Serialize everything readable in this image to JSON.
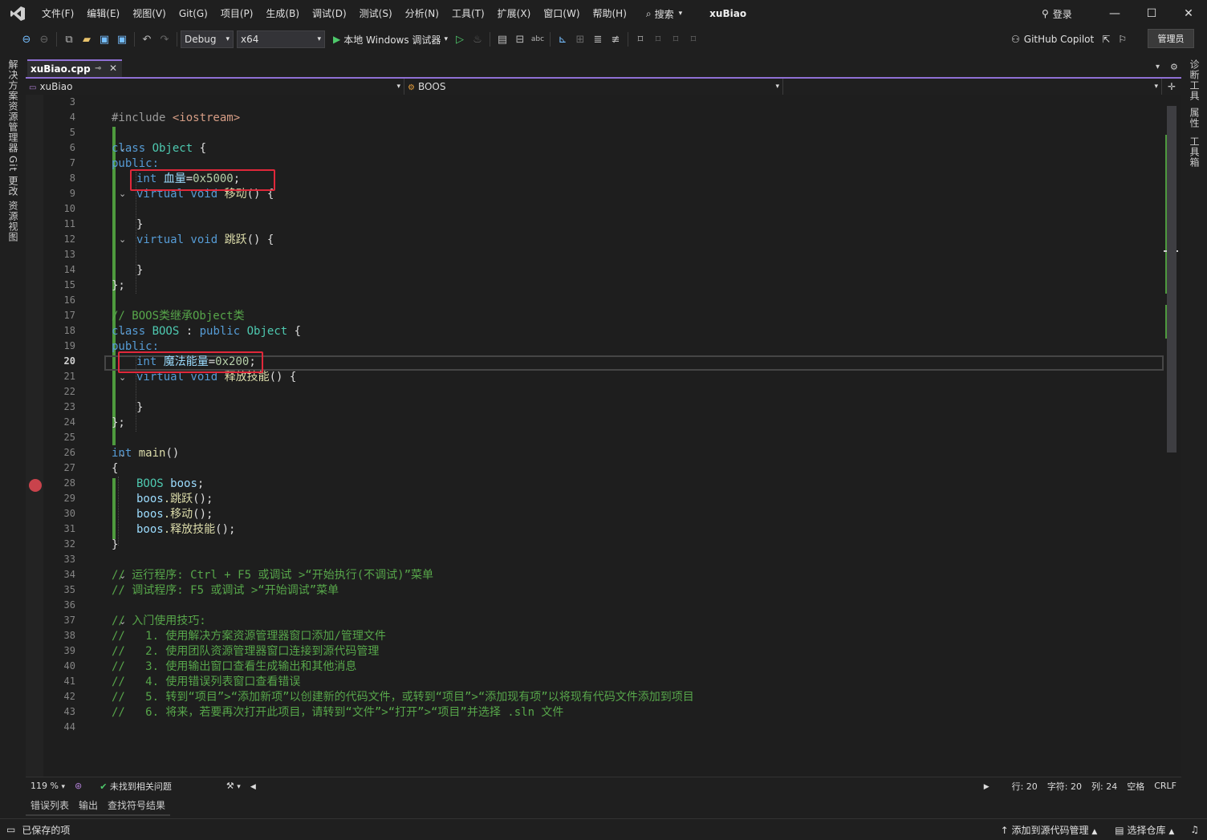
{
  "menubar": {
    "items": [
      "文件(F)",
      "编辑(E)",
      "视图(V)",
      "Git(G)",
      "项目(P)",
      "生成(B)",
      "调试(D)",
      "测试(S)",
      "分析(N)",
      "工具(T)",
      "扩展(X)",
      "窗口(W)",
      "帮助(H)"
    ],
    "search_label": "搜索",
    "window_title": "xuBiao",
    "login_label": "登录"
  },
  "toolbar": {
    "configuration": "Debug",
    "platform": "x64",
    "run_label": "本地 Windows 调试器",
    "copilot_label": "GitHub Copilot",
    "admin_label": "管理员"
  },
  "left_dock": {
    "tabs": [
      "解决方案资源管理器",
      "Git 更改",
      "资源视图"
    ]
  },
  "right_dock": {
    "tabs": [
      "诊断工具",
      "属性",
      "工具箱"
    ]
  },
  "editor_tab": {
    "filename": "xuBiao.cpp"
  },
  "nav_bar": {
    "project": "xuBiao",
    "scope": "BOOS",
    "member": ""
  },
  "editor": {
    "current_line": 20,
    "line_numbers": [
      "3",
      "4",
      "5",
      "6",
      "7",
      "8",
      "9",
      "10",
      "11",
      "12",
      "13",
      "14",
      "15",
      "16",
      "17",
      "18",
      "19",
      "20",
      "21",
      "22",
      "23",
      "24",
      "25",
      "26",
      "27",
      "28",
      "29",
      "30",
      "31",
      "32",
      "33",
      "34",
      "35",
      "36",
      "37",
      "38",
      "39",
      "40",
      "41",
      "42",
      "43",
      "44"
    ],
    "code": {
      "l4_pp": "#include ",
      "l4_inc": "<iostream>",
      "l6_kw": "class ",
      "l6_ty": "Object",
      "l6_rest": " {",
      "l7": "public:",
      "l8_kw": "int ",
      "l8_var": "血量",
      "l8_eq": "=",
      "l8_num": "0x5000",
      "l8_end": ";",
      "l9_kw": "virtual void ",
      "l9_fn": "移动",
      "l9_rest": "() {",
      "l11": "}",
      "l12_kw": "virtual void ",
      "l12_fn": "跳跃",
      "l12_rest": "() {",
      "l14": "}",
      "l15": "};",
      "l17": "// BOOS类继承Object类",
      "l18_kw": "class ",
      "l18_ty": "BOOS",
      "l18_mid": " : ",
      "l18_kw2": "public ",
      "l18_ty2": "Object",
      "l18_rest": " {",
      "l19": "public:",
      "l20_kw": "int ",
      "l20_var": "魔法能量",
      "l20_eq": "=",
      "l20_num": "0x200",
      "l20_end": ";",
      "l21_kw": "virtual void ",
      "l21_fn": "释放技能",
      "l21_rest": "() {",
      "l23": "}",
      "l24": "};",
      "l26_kw": "int ",
      "l26_fn": "main",
      "l26_rest": "()",
      "l27": "{",
      "l28_ty": "BOOS ",
      "l28_var": "boos",
      "l28_end": ";",
      "l29_var": "boos",
      "l29_fn": ".跳跃",
      "l29_end": "();",
      "l30_var": "boos",
      "l30_fn": ".移动",
      "l30_end": "();",
      "l31_var": "boos",
      "l31_fn": ".释放技能",
      "l31_end": "();",
      "l32": "}",
      "l34": "// 运行程序: Ctrl + F5 或调试 >“开始执行(不调试)”菜单",
      "l35": "// 调试程序: F5 或调试 >“开始调试”菜单",
      "l37": "// 入门使用技巧:",
      "l38": "//   1. 使用解决方案资源管理器窗口添加/管理文件",
      "l39": "//   2. 使用团队资源管理器窗口连接到源代码管理",
      "l40": "//   3. 使用输出窗口查看生成输出和其他消息",
      "l41": "//   4. 使用错误列表窗口查看错误",
      "l42": "//   5. 转到“项目”>“添加新项”以创建新的代码文件，或转到“项目”>“添加现有项”以将现有代码文件添加到项目",
      "l43": "//   6. 将来，若要再次打开此项目，请转到“文件”>“打开”>“项目”并选择 .sln 文件"
    }
  },
  "editor_status": {
    "zoom": "119 %",
    "issues": "未找到相关问题",
    "line": "行: 20",
    "char": "字符: 20",
    "col": "列: 24",
    "whitespace": "空格",
    "line_ending": "CRLF"
  },
  "tool_tabs": [
    "错误列表",
    "输出",
    "查找符号结果"
  ],
  "statusbar": {
    "saved": "已保存的项",
    "add_source_control": "添加到源代码管理",
    "select_repo": "选择仓库"
  },
  "colors": {
    "accent": "#8f6fd5",
    "keyword": "#569cd6",
    "type": "#4ec9b0",
    "comment": "#57a64a",
    "highlight_box": "#e0283a",
    "breakpoint": "#c9434c",
    "change_bar": "#4e9a3e"
  }
}
